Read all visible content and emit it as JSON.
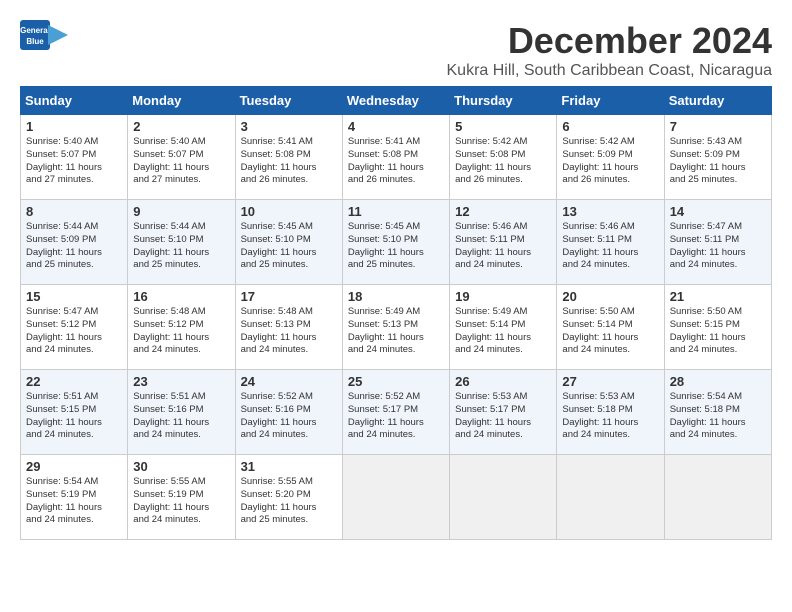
{
  "logo": {
    "line1": "General",
    "line2": "Blue"
  },
  "title": "December 2024",
  "location": "Kukra Hill, South Caribbean Coast, Nicaragua",
  "days_of_week": [
    "Sunday",
    "Monday",
    "Tuesday",
    "Wednesday",
    "Thursday",
    "Friday",
    "Saturday"
  ],
  "weeks": [
    [
      {
        "day": "1",
        "info": "Sunrise: 5:40 AM\nSunset: 5:07 PM\nDaylight: 11 hours\nand 27 minutes."
      },
      {
        "day": "2",
        "info": "Sunrise: 5:40 AM\nSunset: 5:07 PM\nDaylight: 11 hours\nand 27 minutes."
      },
      {
        "day": "3",
        "info": "Sunrise: 5:41 AM\nSunset: 5:08 PM\nDaylight: 11 hours\nand 26 minutes."
      },
      {
        "day": "4",
        "info": "Sunrise: 5:41 AM\nSunset: 5:08 PM\nDaylight: 11 hours\nand 26 minutes."
      },
      {
        "day": "5",
        "info": "Sunrise: 5:42 AM\nSunset: 5:08 PM\nDaylight: 11 hours\nand 26 minutes."
      },
      {
        "day": "6",
        "info": "Sunrise: 5:42 AM\nSunset: 5:09 PM\nDaylight: 11 hours\nand 26 minutes."
      },
      {
        "day": "7",
        "info": "Sunrise: 5:43 AM\nSunset: 5:09 PM\nDaylight: 11 hours\nand 25 minutes."
      }
    ],
    [
      {
        "day": "8",
        "info": "Sunrise: 5:44 AM\nSunset: 5:09 PM\nDaylight: 11 hours\nand 25 minutes."
      },
      {
        "day": "9",
        "info": "Sunrise: 5:44 AM\nSunset: 5:10 PM\nDaylight: 11 hours\nand 25 minutes."
      },
      {
        "day": "10",
        "info": "Sunrise: 5:45 AM\nSunset: 5:10 PM\nDaylight: 11 hours\nand 25 minutes."
      },
      {
        "day": "11",
        "info": "Sunrise: 5:45 AM\nSunset: 5:10 PM\nDaylight: 11 hours\nand 25 minutes."
      },
      {
        "day": "12",
        "info": "Sunrise: 5:46 AM\nSunset: 5:11 PM\nDaylight: 11 hours\nand 24 minutes."
      },
      {
        "day": "13",
        "info": "Sunrise: 5:46 AM\nSunset: 5:11 PM\nDaylight: 11 hours\nand 24 minutes."
      },
      {
        "day": "14",
        "info": "Sunrise: 5:47 AM\nSunset: 5:11 PM\nDaylight: 11 hours\nand 24 minutes."
      }
    ],
    [
      {
        "day": "15",
        "info": "Sunrise: 5:47 AM\nSunset: 5:12 PM\nDaylight: 11 hours\nand 24 minutes."
      },
      {
        "day": "16",
        "info": "Sunrise: 5:48 AM\nSunset: 5:12 PM\nDaylight: 11 hours\nand 24 minutes."
      },
      {
        "day": "17",
        "info": "Sunrise: 5:48 AM\nSunset: 5:13 PM\nDaylight: 11 hours\nand 24 minutes."
      },
      {
        "day": "18",
        "info": "Sunrise: 5:49 AM\nSunset: 5:13 PM\nDaylight: 11 hours\nand 24 minutes."
      },
      {
        "day": "19",
        "info": "Sunrise: 5:49 AM\nSunset: 5:14 PM\nDaylight: 11 hours\nand 24 minutes."
      },
      {
        "day": "20",
        "info": "Sunrise: 5:50 AM\nSunset: 5:14 PM\nDaylight: 11 hours\nand 24 minutes."
      },
      {
        "day": "21",
        "info": "Sunrise: 5:50 AM\nSunset: 5:15 PM\nDaylight: 11 hours\nand 24 minutes."
      }
    ],
    [
      {
        "day": "22",
        "info": "Sunrise: 5:51 AM\nSunset: 5:15 PM\nDaylight: 11 hours\nand 24 minutes."
      },
      {
        "day": "23",
        "info": "Sunrise: 5:51 AM\nSunset: 5:16 PM\nDaylight: 11 hours\nand 24 minutes."
      },
      {
        "day": "24",
        "info": "Sunrise: 5:52 AM\nSunset: 5:16 PM\nDaylight: 11 hours\nand 24 minutes."
      },
      {
        "day": "25",
        "info": "Sunrise: 5:52 AM\nSunset: 5:17 PM\nDaylight: 11 hours\nand 24 minutes."
      },
      {
        "day": "26",
        "info": "Sunrise: 5:53 AM\nSunset: 5:17 PM\nDaylight: 11 hours\nand 24 minutes."
      },
      {
        "day": "27",
        "info": "Sunrise: 5:53 AM\nSunset: 5:18 PM\nDaylight: 11 hours\nand 24 minutes."
      },
      {
        "day": "28",
        "info": "Sunrise: 5:54 AM\nSunset: 5:18 PM\nDaylight: 11 hours\nand 24 minutes."
      }
    ],
    [
      {
        "day": "29",
        "info": "Sunrise: 5:54 AM\nSunset: 5:19 PM\nDaylight: 11 hours\nand 24 minutes."
      },
      {
        "day": "30",
        "info": "Sunrise: 5:55 AM\nSunset: 5:19 PM\nDaylight: 11 hours\nand 24 minutes."
      },
      {
        "day": "31",
        "info": "Sunrise: 5:55 AM\nSunset: 5:20 PM\nDaylight: 11 hours\nand 25 minutes."
      },
      {
        "day": "",
        "info": ""
      },
      {
        "day": "",
        "info": ""
      },
      {
        "day": "",
        "info": ""
      },
      {
        "day": "",
        "info": ""
      }
    ]
  ]
}
